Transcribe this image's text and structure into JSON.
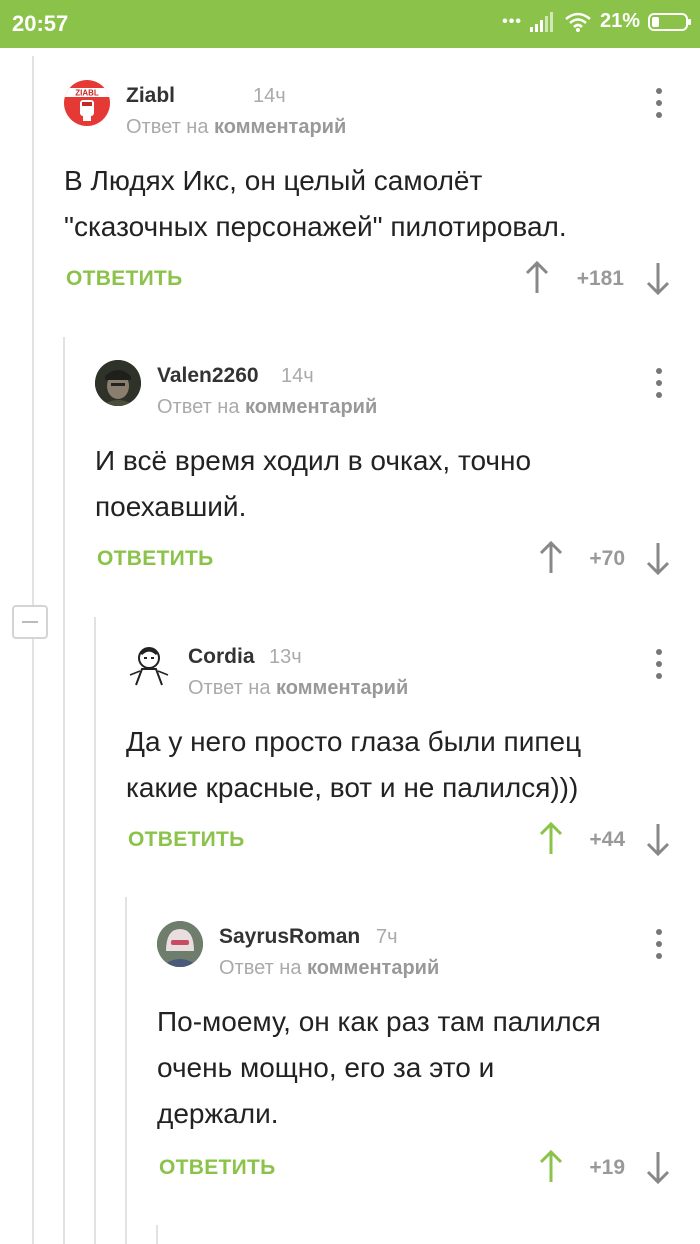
{
  "status_bar": {
    "time": "20:57",
    "signal_dots": "•••",
    "battery_percent": "21%",
    "battery_level": 0.21
  },
  "reply_to_prefix": "Ответ на",
  "reply_to_target": "комментарий",
  "reply_label": "ОТВЕТИТЬ",
  "colors": {
    "accent": "#8bc34a",
    "muted": "#999999",
    "upvoted": "#8bc34a",
    "neutral_arrow": "#888888"
  },
  "comments": [
    {
      "author": "Ziabl",
      "time": "14ч",
      "avatar_icon": "red-fist-avatar-icon",
      "avatar_text": "ZIABL",
      "lines": [
        "В Людях Икс, он целый самолёт",
        "\"сказочных персонажей\" пилотировал."
      ],
      "score": "+181",
      "upvoted": false
    },
    {
      "author": "Valen2260",
      "time": "14ч",
      "avatar_icon": "soldier-avatar-icon",
      "lines": [
        "И всё время ходил в очках, точно",
        "поехавший."
      ],
      "score": "+70",
      "upvoted": false
    },
    {
      "author": "Cordia",
      "time": "13ч",
      "avatar_icon": "sketch-face-avatar-icon",
      "lines": [
        "Да у него просто глаза были пипец",
        "какие красные, вот и не палился)))"
      ],
      "score": "+44",
      "upvoted": true
    },
    {
      "author": "SayrusRoman",
      "time": "7ч",
      "avatar_icon": "masked-person-avatar-icon",
      "lines": [
        "По-моему, он как раз там палился",
        "очень мощно, его за это и",
        "держали."
      ],
      "score": "+19",
      "upvoted": true
    }
  ]
}
